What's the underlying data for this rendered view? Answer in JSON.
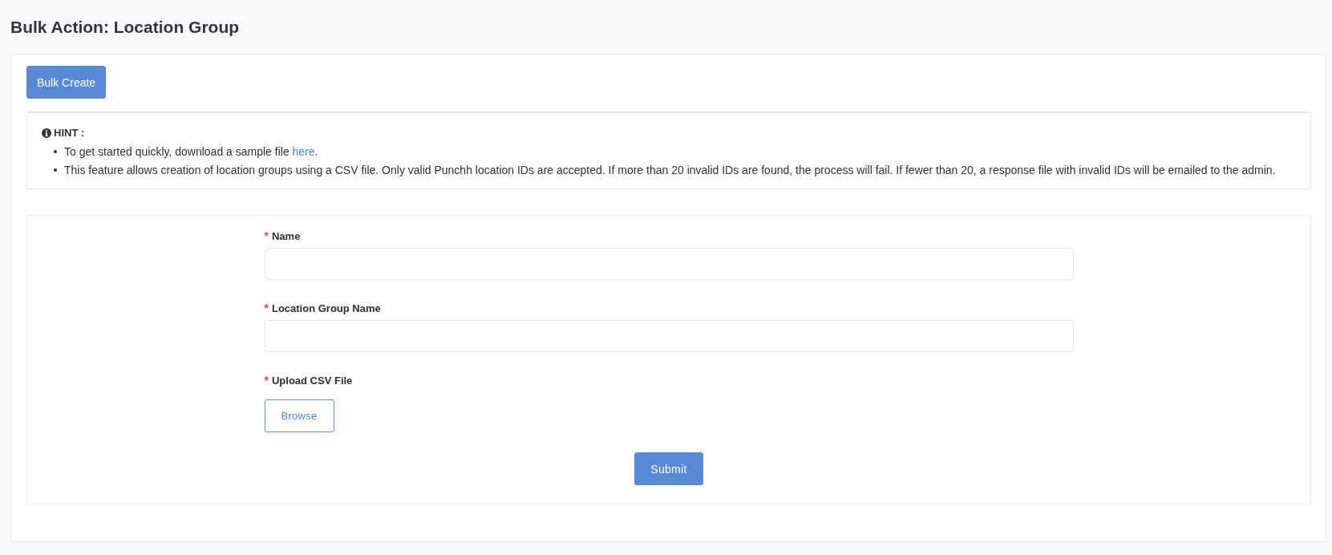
{
  "page": {
    "title": "Bulk Action: Location Group"
  },
  "toolbar": {
    "buttons": [
      {
        "label": "Bulk Create"
      }
    ]
  },
  "hint": {
    "title": "HINT :",
    "items": [
      {
        "text": "To get started quickly, download a sample file ",
        "link": "here",
        "after": "."
      },
      {
        "text": "This feature allows creation of location groups using a CSV file. Only valid Punchh location IDs are accepted. If more than 20 invalid IDs are found, the process will fail. If fewer than 20, a response file with invalid IDs will be emailed to the admin."
      }
    ]
  },
  "form": {
    "fields": [
      {
        "kind": "text",
        "label": "Name",
        "required_mark": "*"
      },
      {
        "kind": "text",
        "label": "Location Group Name",
        "required_mark": "*"
      },
      {
        "kind": "file",
        "label": "Upload CSV File",
        "required_mark": "*",
        "button": "Browse"
      }
    ],
    "submit": "Submit"
  }
}
